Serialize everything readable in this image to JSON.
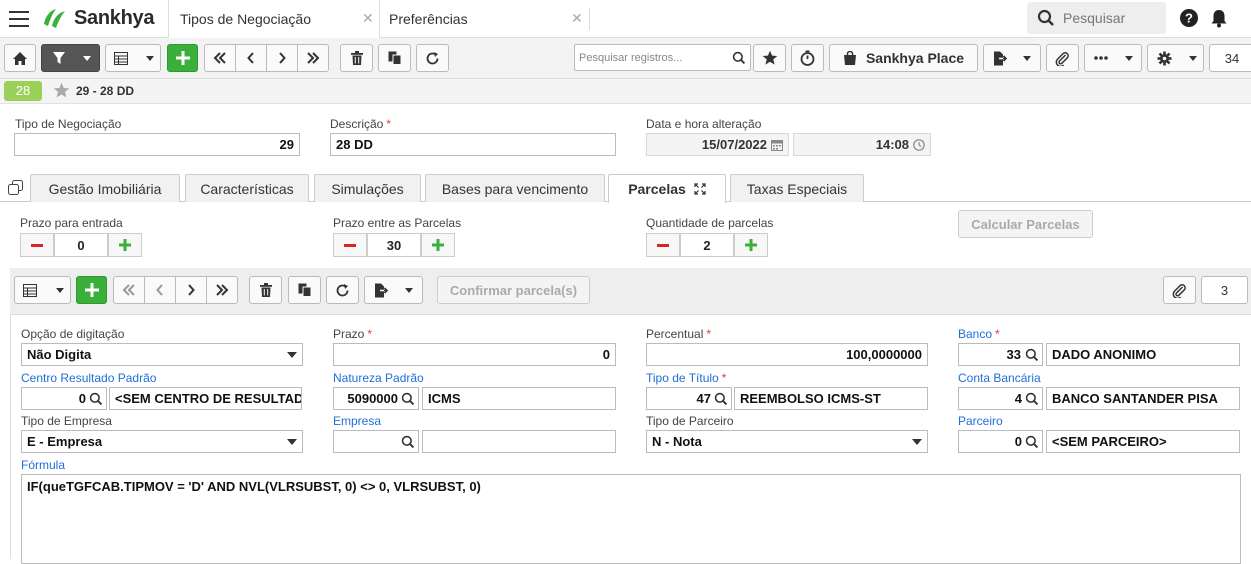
{
  "brand": {
    "name": "Sankhya",
    "green": "#3aaf3a"
  },
  "tabs": [
    {
      "label": "Tipos de Negociação"
    },
    {
      "label": "Preferências"
    }
  ],
  "header": {
    "search_placeholder": "Pesquisar"
  },
  "toolbar": {
    "search_placeholder": "Pesquisar registros...",
    "place_label": "Sankhya Place",
    "count": "34"
  },
  "record": {
    "badge": "28",
    "title": "29 - 28 DD"
  },
  "form": {
    "tipo_label": "Tipo de Negociação",
    "tipo_value": "29",
    "descricao_label": "Descrição",
    "descricao_value": "28 DD",
    "data_label": "Data e hora alteração",
    "data_value": "15/07/2022",
    "hora_value": "14:08"
  },
  "form_tabs": [
    {
      "label": "Gestão Imobiliária"
    },
    {
      "label": "Características"
    },
    {
      "label": "Simulações"
    },
    {
      "label": "Bases para vencimento"
    },
    {
      "label": "Parcelas"
    },
    {
      "label": "Taxas Especiais"
    }
  ],
  "parcelas": {
    "prazo_entrada_label": "Prazo para entrada",
    "prazo_entrada": "0",
    "prazo_parcelas_label": "Prazo entre as Parcelas",
    "prazo_parcelas": "30",
    "qtd_label": "Quantidade de parcelas",
    "qtd": "2",
    "calcular_label": "Calcular Parcelas",
    "confirmar_label": "Confirmar parcela(s)",
    "sub_count": "3"
  },
  "detail": {
    "opcao_label": "Opção de digitação",
    "opcao_value": "Não Digita",
    "prazo_label": "Prazo",
    "prazo_value": "0",
    "percentual_label": "Percentual",
    "percentual_value": "100,0000000",
    "banco_label": "Banco",
    "banco_code": "33",
    "banco_name": "DADO ANONIMO",
    "cr_label": "Centro Resultado Padrão",
    "cr_code": "0",
    "cr_name": "<SEM CENTRO DE RESULTADO>",
    "natureza_label": "Natureza Padrão",
    "natureza_code": "5090000",
    "natureza_name": "ICMS",
    "titulo_label": "Tipo de Título",
    "titulo_code": "47",
    "titulo_name": "REEMBOLSO ICMS-ST",
    "conta_label": "Conta Bancária",
    "conta_code": "4",
    "conta_name": "BANCO SANTANDER PISA",
    "tipo_empresa_label": "Tipo de Empresa",
    "tipo_empresa_value": "E - Empresa",
    "empresa_label": "Empresa",
    "empresa_code": "",
    "empresa_name": "",
    "tipo_parceiro_label": "Tipo de Parceiro",
    "tipo_parceiro_value": "N - Nota",
    "parceiro_label": "Parceiro",
    "parceiro_code": "0",
    "parceiro_name": "<SEM PARCEIRO>",
    "formula_label": "Fórmula",
    "formula_value": "IF(queTGFCAB.TIPMOV = 'D' AND NVL(VLRSUBST, 0) <> 0, VLRSUBST, 0)"
  }
}
